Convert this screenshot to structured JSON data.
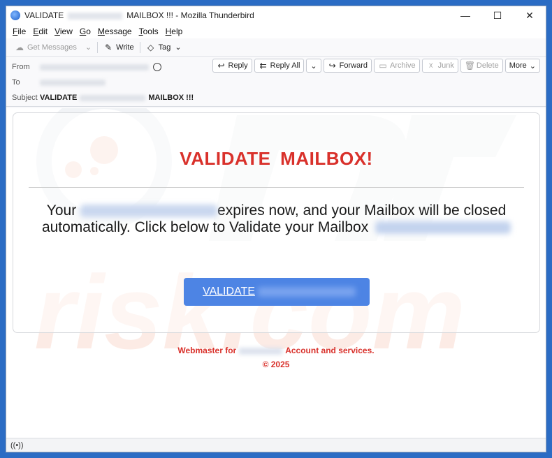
{
  "window": {
    "title_prefix": "VALIDATE",
    "title_suffix": "MAILBOX !!! - Mozilla Thunderbird",
    "controls": {
      "minimize": "—",
      "maximize": "☐",
      "close": "✕"
    }
  },
  "menu": [
    {
      "label": "File",
      "accel": "F",
      "rest": "ile"
    },
    {
      "label": "Edit",
      "accel": "E",
      "rest": "dit"
    },
    {
      "label": "View",
      "accel": "V",
      "rest": "iew"
    },
    {
      "label": "Go",
      "accel": "G",
      "rest": "o"
    },
    {
      "label": "Message",
      "accel": "M",
      "rest": "essage"
    },
    {
      "label": "Tools",
      "accel": "T",
      "rest": "ools"
    },
    {
      "label": "Help",
      "accel": "H",
      "rest": "elp"
    }
  ],
  "toolbar": {
    "get_messages": "Get Messages",
    "write": "Write",
    "tag": "Tag"
  },
  "header": {
    "from_label": "From",
    "to_label": "To",
    "subject_label": "Subject",
    "subject_prefix": "VALIDATE",
    "subject_suffix": "MAILBOX !!!",
    "actions": {
      "reply": "Reply",
      "reply_all": "Reply All",
      "forward": "Forward",
      "archive": "Archive",
      "junk": "Junk",
      "delete": "Delete",
      "more": "More"
    }
  },
  "email": {
    "headline": "VALIDATE MAILBOX!",
    "para_start": "Your",
    "para_mid": "expires now, and your Mailbox will be closed automatically. Click below to Validate your Mailbox",
    "button_label": "VALIDATE",
    "footer_start": "Webmaster for",
    "footer_end": "Account and services.",
    "copyright": "© 2025"
  },
  "colors": {
    "accent_red": "#d9312b",
    "button_blue": "#4d84e4",
    "window_frame": "#2b6cc4"
  }
}
